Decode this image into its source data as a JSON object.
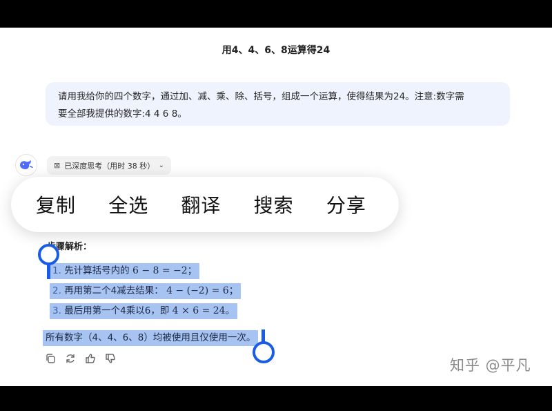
{
  "conversation": {
    "title": "用4、4、6、8运算得24"
  },
  "user_message": {
    "line1": "请用我给你的四个数字，通过加、减、乘、除、括号，组成一个运算，使得结果为24。注意:数字需",
    "line2": "要全部我提供的数字:4 4 6 8。"
  },
  "assistant": {
    "think_chip": "已深度思考（用时 38 秒）",
    "steps_title": "步骤解析：",
    "steps": [
      {
        "num": "1.",
        "text": "先计算括号内的",
        "math": "6 − 8 = −2",
        "tail": "；"
      },
      {
        "num": "2.",
        "text": "再用第二个4减去结果：",
        "math": "4 − (−2) = 6",
        "tail": "；"
      },
      {
        "num": "3.",
        "text": "最后用第一个4乘以6，即",
        "math": "4 × 6 = 24",
        "tail": "。"
      }
    ],
    "summary": "所有数字（4、4、6、8）均被使用且仅使用一次。"
  },
  "context_menu": {
    "items": [
      "复制",
      "全选",
      "翻译",
      "搜索",
      "分享"
    ]
  },
  "message_actions": [
    "copy-icon",
    "regenerate-icon",
    "thumbs-up-icon",
    "thumbs-down-icon"
  ],
  "watermark": "知乎 @平凡",
  "colors": {
    "selection": "#a6c3f2",
    "handle": "#1a5ce6",
    "user_bubble": "#eef3fd",
    "brand": "#4d6bfe"
  }
}
